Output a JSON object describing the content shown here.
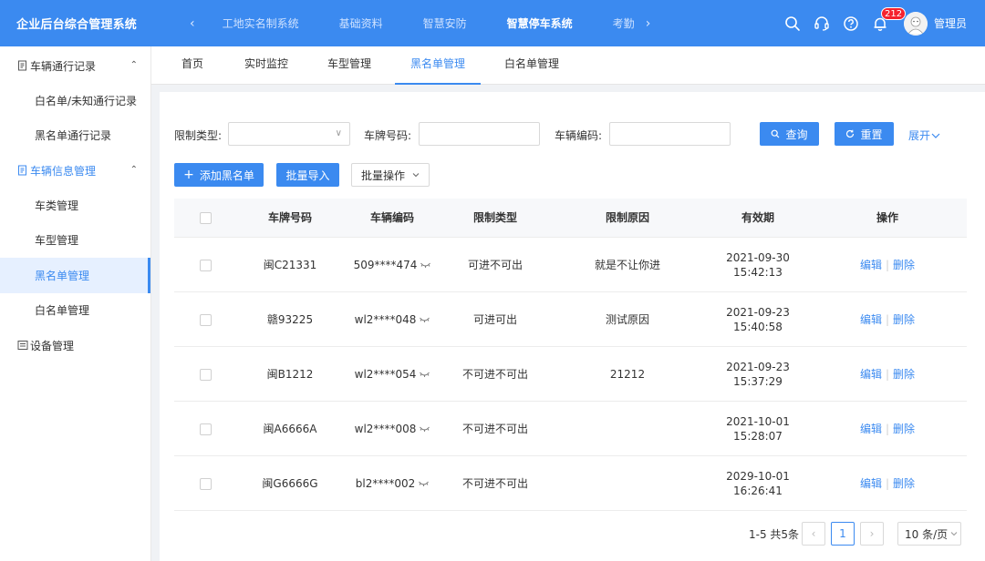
{
  "app": {
    "title": "企业后台综合管理系统",
    "systems": [
      "工地实名制系统",
      "基础资料",
      "智慧安防",
      "智慧停车系统",
      "考勤"
    ],
    "active_system_index": 3,
    "notification_count": "212",
    "username": "管理员"
  },
  "sidebar": {
    "groups": [
      {
        "label": "车辆通行记录",
        "expanded": true
      },
      {
        "label": "车辆信息管理",
        "expanded": true
      },
      {
        "label": "设备管理",
        "expanded": false
      }
    ],
    "records_items": [
      "白名单/未知通行记录",
      "黑名单通行记录"
    ],
    "info_items": [
      "车类管理",
      "车型管理",
      "黑名单管理",
      "白名单管理"
    ],
    "active_item": "黑名单管理"
  },
  "tabs": [
    "首页",
    "实时监控",
    "车型管理",
    "黑名单管理",
    "白名单管理"
  ],
  "active_tab": "黑名单管理",
  "filters": {
    "restriction_type_label": "限制类型:",
    "restriction_type_value": "",
    "plate_label": "车牌号码:",
    "plate_value": "",
    "vehicle_code_label": "车辆编码:",
    "vehicle_code_value": "",
    "search_button": "查询",
    "reset_button": "重置",
    "expand_link": "展开"
  },
  "actions": {
    "add_button": "添加黑名单",
    "import_button": "批量导入",
    "batch_button": "批量操作"
  },
  "table": {
    "columns": [
      "车牌号码",
      "车辆编码",
      "限制类型",
      "限制原因",
      "有效期",
      "操作"
    ],
    "rows": [
      {
        "plate": "闽C21331",
        "code": "509****474",
        "type": "可进不可出",
        "reason": "就是不让你进",
        "date": "2021-09-30",
        "time": "15:42:13"
      },
      {
        "plate": "赣93225",
        "code": "wl2****048",
        "type": "可进可出",
        "reason": "测试原因",
        "date": "2021-09-23",
        "time": "15:40:58"
      },
      {
        "plate": "闽B1212",
        "code": "wl2****054",
        "type": "不可进不可出",
        "reason": "21212",
        "date": "2021-09-23",
        "time": "15:37:29"
      },
      {
        "plate": "闽A6666A",
        "code": "wl2****008",
        "type": "不可进不可出",
        "reason": "",
        "date": "2021-10-01",
        "time": "15:28:07"
      },
      {
        "plate": "闽G6666G",
        "code": "bl2****002",
        "type": "不可进不可出",
        "reason": "",
        "date": "2029-10-01",
        "time": "16:26:41"
      }
    ],
    "edit_label": "编辑",
    "delete_label": "删除"
  },
  "pagination": {
    "total_text": "1-5 共5条",
    "current_page": "1",
    "page_size": "10 条/页"
  },
  "colors": {
    "primary": "#3b8af0",
    "header_bg": "#3b8af0",
    "danger": "#f5222d"
  }
}
